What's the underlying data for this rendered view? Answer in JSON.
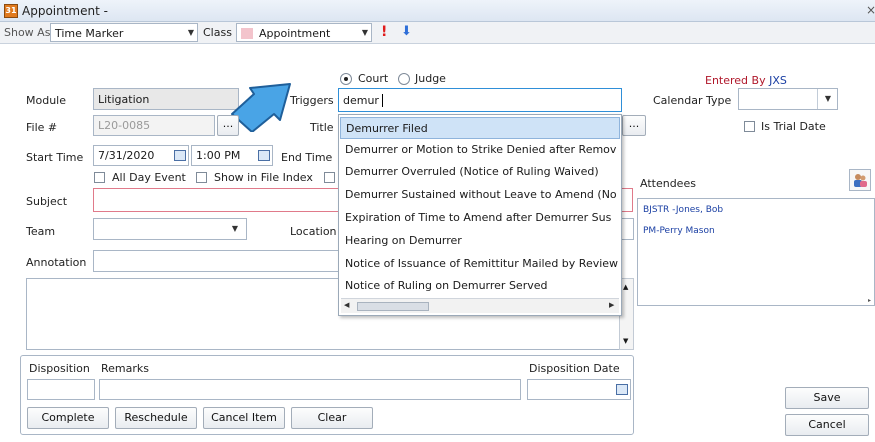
{
  "window": {
    "title": "Appointment -",
    "close": "×",
    "icon_text": "31"
  },
  "toolbar": {
    "show_as_label": "Show As",
    "show_as_value": "Time Marker",
    "class_label": "Class",
    "class_value": "Appointment",
    "priority": "!",
    "down": "⬇"
  },
  "mode": {
    "court": "Court",
    "judge": "Judge",
    "selected": "Court"
  },
  "entered_by": {
    "label": "Entered By",
    "value": "JXS"
  },
  "form": {
    "module_label": "Module",
    "module_value": "Litigation",
    "file_label": "File #",
    "file_value": "L20-0085",
    "start_time_label": "Start Time",
    "start_date": "7/31/2020",
    "start_clock": "1:00 PM",
    "end_time_label": "End Time",
    "all_day": "All Day Event",
    "show_in_file_index": "Show in File Index",
    "subject_label": "Subject",
    "team_label": "Team",
    "annotation_label": "Annotation",
    "triggers_label": "Triggers",
    "triggers_value": "demur",
    "title_label": "Title",
    "location_label": "Location",
    "calendar_type_label": "Calendar Type",
    "is_trial_date": "Is Trial Date",
    "attendees_label": "Attendees",
    "ellipsis": "..."
  },
  "dropdown_items": [
    "Demurrer Filed",
    "Demurrer or Motion to Strike Denied after Remov",
    "Demurrer Overruled (Notice of Ruling Waived)",
    "Demurrer Sustained without Leave to Amend (No",
    "Expiration of Time to Amend after Demurrer Sus",
    "Hearing on Demurrer",
    "Notice of Issuance of Remittitur Mailed by Review",
    "Notice of Ruling on Demurrer Served"
  ],
  "attendees": [
    "BJSTR  -Jones, Bob",
    "PM-Perry Mason"
  ],
  "disposition": {
    "disposition_label": "Disposition",
    "remarks_label": "Remarks",
    "date_label": "Disposition Date"
  },
  "buttons": {
    "complete": "Complete",
    "reschedule": "Reschedule",
    "cancel_item": "Cancel Item",
    "clear": "Clear",
    "save": "Save",
    "cancel": "Cancel"
  },
  "colors": {
    "accent_blue": "#2f8fd8",
    "entered_by_red": "#b0182b",
    "attendee_blue": "#1a3fa3"
  }
}
